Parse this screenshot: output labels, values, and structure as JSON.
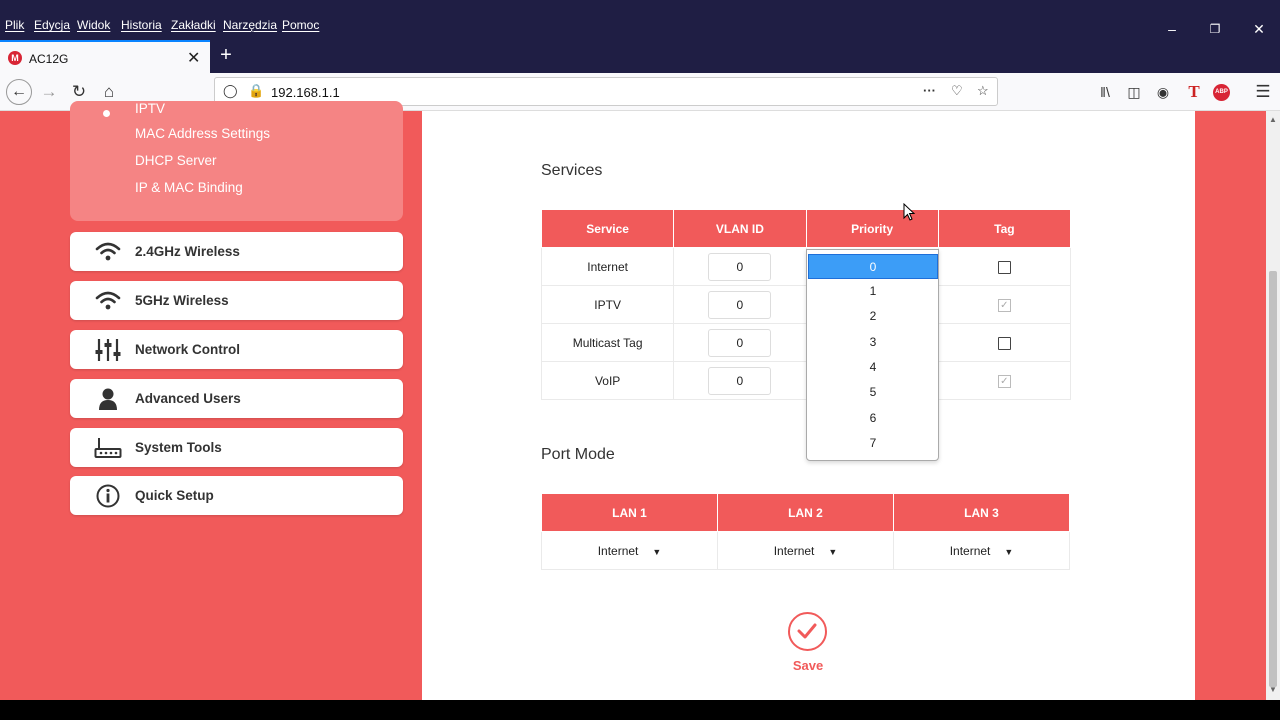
{
  "menu": [
    "Plik",
    "Edycja",
    "Widok",
    "Historia",
    "Zakładki",
    "Narzędzia",
    "Pomoc"
  ],
  "tab": {
    "title": "AC12G",
    "favicon_letter": "M"
  },
  "url": "192.168.1.1",
  "sidebar": {
    "sub_items": [
      "IPTV",
      "MAC Address Settings",
      "DHCP Server",
      "IP & MAC Binding"
    ],
    "items": [
      {
        "label": "2.4GHz Wireless",
        "icon": "wifi-icon"
      },
      {
        "label": "5GHz Wireless",
        "icon": "wifi-icon"
      },
      {
        "label": "Network Control",
        "icon": "sliders-icon"
      },
      {
        "label": "Advanced Users",
        "icon": "user-icon"
      },
      {
        "label": "System Tools",
        "icon": "router-icon"
      },
      {
        "label": "Quick Setup",
        "icon": "info-icon"
      }
    ]
  },
  "services": {
    "title": "Services",
    "headers": [
      "Service",
      "VLAN ID",
      "Priority",
      "Tag"
    ],
    "rows": [
      {
        "service": "Internet",
        "vlan": "0",
        "tag": "unchecked"
      },
      {
        "service": "IPTV",
        "vlan": "0",
        "tag": "checked-disabled"
      },
      {
        "service": "Multicast Tag",
        "vlan": "0",
        "tag": "unchecked"
      },
      {
        "service": "VoIP",
        "vlan": "0",
        "tag": "checked-disabled"
      }
    ],
    "priority_options": [
      "0",
      "1",
      "2",
      "3",
      "4",
      "5",
      "6",
      "7"
    ],
    "priority_selected": "0"
  },
  "port_mode": {
    "title": "Port Mode",
    "headers": [
      "LAN 1",
      "LAN 2",
      "LAN 3"
    ],
    "values": [
      "Internet",
      "Internet",
      "Internet"
    ]
  },
  "save_label": "Save",
  "colors": {
    "accent": "#f15a5a",
    "titlebar": "#1f1e44",
    "selected": "#3c9df7"
  }
}
